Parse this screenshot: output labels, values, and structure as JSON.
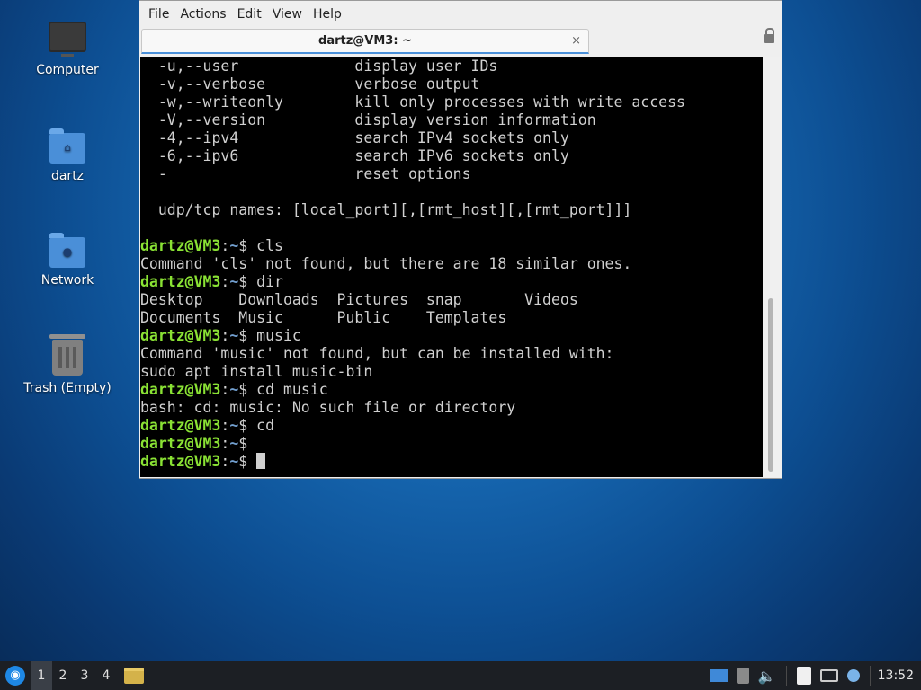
{
  "desktop": {
    "icons": [
      {
        "label": "Computer"
      },
      {
        "label": "dartz"
      },
      {
        "label": "Network"
      },
      {
        "label": "Trash (Empty)"
      }
    ]
  },
  "window": {
    "menu": [
      "File",
      "Actions",
      "Edit",
      "View",
      "Help"
    ],
    "tab_title": "dartz@VM3: ~",
    "tab_close": "×"
  },
  "terminal": {
    "lines": [
      {
        "text": "  -u,--user             display user IDs"
      },
      {
        "text": "  -v,--verbose          verbose output"
      },
      {
        "text": "  -w,--writeonly        kill only processes with write access"
      },
      {
        "text": "  -V,--version          display version information"
      },
      {
        "text": "  -4,--ipv4             search IPv4 sockets only"
      },
      {
        "text": "  -6,--ipv6             search IPv6 sockets only"
      },
      {
        "text": "  -                     reset options"
      },
      {
        "text": ""
      },
      {
        "text": "  udp/tcp names: [local_port][,[rmt_host][,[rmt_port]]]"
      },
      {
        "text": ""
      },
      {
        "prompt": "dartz@VM3",
        "path": "~",
        "cmd": " cls"
      },
      {
        "text": "Command 'cls' not found, but there are 18 similar ones."
      },
      {
        "prompt": "dartz@VM3",
        "path": "~",
        "cmd": " dir"
      },
      {
        "text": "Desktop    Downloads  Pictures  snap       Videos"
      },
      {
        "text": "Documents  Music      Public    Templates"
      },
      {
        "prompt": "dartz@VM3",
        "path": "~",
        "cmd": " music"
      },
      {
        "text": "Command 'music' not found, but can be installed with:"
      },
      {
        "text": "sudo apt install music-bin"
      },
      {
        "prompt": "dartz@VM3",
        "path": "~",
        "cmd": " cd music"
      },
      {
        "text": "bash: cd: music: No such file or directory"
      },
      {
        "prompt": "dartz@VM3",
        "path": "~",
        "cmd": " cd"
      },
      {
        "prompt": "dartz@VM3",
        "path": "~",
        "cmd": ""
      },
      {
        "prompt": "dartz@VM3",
        "path": "~",
        "cmd": " ",
        "cursor": true
      }
    ]
  },
  "taskbar": {
    "workspaces": [
      "1",
      "2",
      "3",
      "4"
    ],
    "active_workspace": "1",
    "clock": "13:52"
  }
}
